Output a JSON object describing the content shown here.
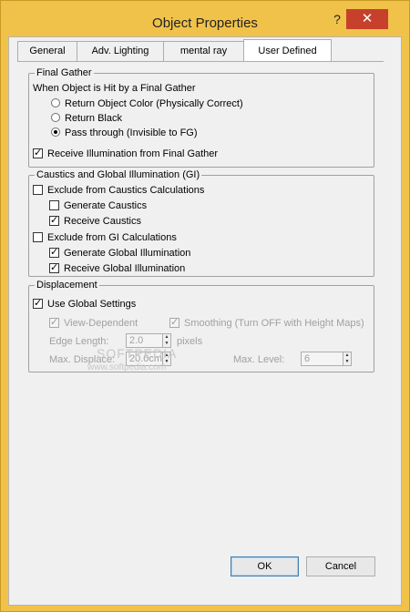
{
  "window": {
    "title": "Object Properties",
    "help_glyph": "?",
    "close_glyph": "✕"
  },
  "tabs": [
    {
      "label": "General"
    },
    {
      "label": "Adv. Lighting"
    },
    {
      "label": "mental ray"
    },
    {
      "label": "User Defined"
    }
  ],
  "final_gather": {
    "title": "Final Gather",
    "subtitle": "When Object is Hit by a Final Gather",
    "options": [
      {
        "label": "Return Object Color (Physically Correct)",
        "selected": false
      },
      {
        "label": "Return Black",
        "selected": false
      },
      {
        "label": "Pass through (Invisible to FG)",
        "selected": true
      }
    ],
    "receive_label": "Receive Illumination from Final Gather",
    "receive_checked": true
  },
  "caustics_gi": {
    "title": "Caustics and Global Illumination (GI)",
    "exclude_caustics_label": "Exclude from Caustics Calculations",
    "exclude_caustics_checked": false,
    "generate_caustics_label": "Generate Caustics",
    "generate_caustics_checked": false,
    "receive_caustics_label": "Receive Caustics",
    "receive_caustics_checked": true,
    "exclude_gi_label": "Exclude from GI Calculations",
    "exclude_gi_checked": false,
    "generate_gi_label": "Generate Global Illumination",
    "generate_gi_checked": true,
    "receive_gi_label": "Receive Global Illumination",
    "receive_gi_checked": true
  },
  "displacement": {
    "title": "Displacement",
    "use_global_label": "Use Global Settings",
    "use_global_checked": true,
    "view_dependent_label": "View-Dependent",
    "view_dependent_checked": true,
    "smoothing_label": "Smoothing (Turn OFF with Height Maps)",
    "smoothing_checked": true,
    "edge_length_label": "Edge Length:",
    "edge_length_value": "2.0",
    "edge_length_unit": "pixels",
    "max_displace_label": "Max. Displace:",
    "max_displace_value": "20.0cm",
    "max_level_label": "Max. Level:",
    "max_level_value": "6"
  },
  "watermark": {
    "line1": "SOFTPEDIA",
    "line2": "www.softpedia.com"
  },
  "buttons": {
    "ok": "OK",
    "cancel": "Cancel"
  },
  "colors": {
    "title_bar": "#f0c24a",
    "close_button": "#c7402c",
    "dialog_face": "#f0f0f0"
  }
}
